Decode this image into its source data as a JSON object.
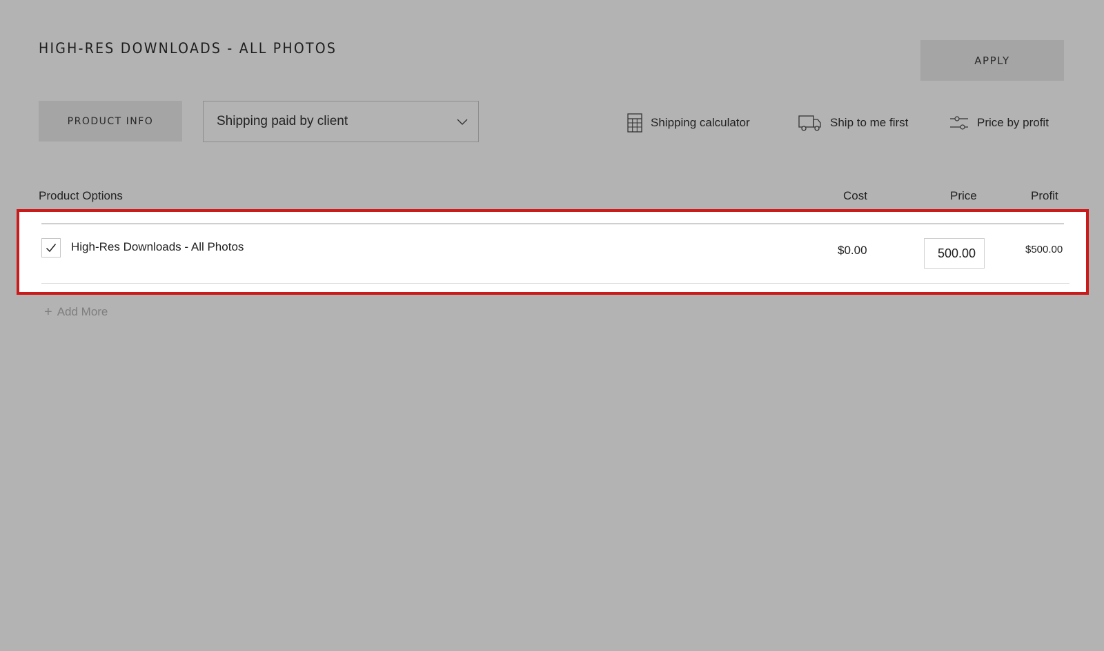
{
  "header": {
    "title": "HIGH-RES DOWNLOADS - ALL PHOTOS",
    "apply_label": "APPLY"
  },
  "toolbar": {
    "product_info_label": "PRODUCT INFO",
    "shipping_select": {
      "selected": "Shipping paid by client"
    },
    "tools": [
      {
        "label": "Shipping calculator",
        "icon": "calculator-icon"
      },
      {
        "label": "Ship to me first",
        "icon": "truck-icon"
      },
      {
        "label": "Price by profit",
        "icon": "sliders-icon"
      }
    ]
  },
  "table": {
    "headers": {
      "options": "Product Options",
      "cost": "Cost",
      "price": "Price",
      "profit": "Profit"
    },
    "rows": [
      {
        "checked": true,
        "name": "High-Res Downloads - All Photos",
        "cost": "$0.00",
        "price": "500.00",
        "profit": "$500.00"
      }
    ],
    "add_more_label": "Add More"
  },
  "colors": {
    "background": "#b3b3b3",
    "button_bg": "#a5a5a5",
    "highlight_border": "#cc1a1a",
    "row_bg": "#ffffff"
  }
}
